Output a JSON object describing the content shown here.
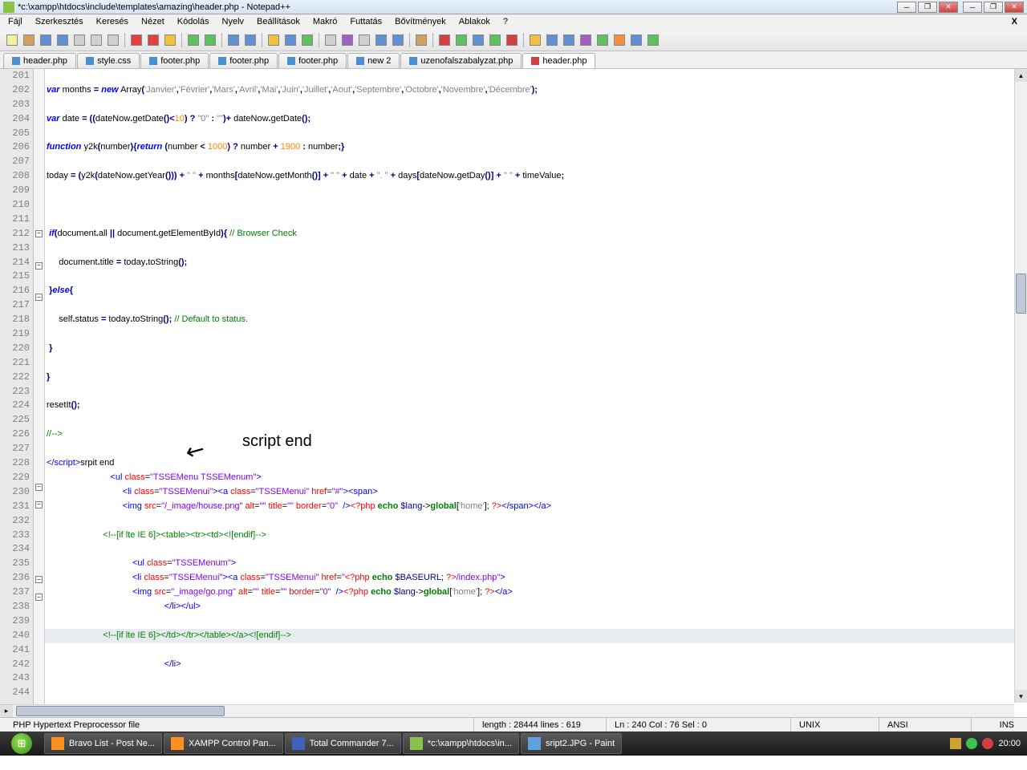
{
  "title": "*c:\\xampp\\htdocs\\include\\templates\\amazing\\header.php - Notepad++",
  "menus": [
    "Fájl",
    "Szerkesztés",
    "Keresés",
    "Nézet",
    "Kódolás",
    "Nyelv",
    "Beállítások",
    "Makró",
    "Futtatás",
    "Bővítmények",
    "Ablakok",
    "?"
  ],
  "tabs": [
    {
      "label": "header.php",
      "active": false,
      "mod": false
    },
    {
      "label": "style.css",
      "active": false,
      "mod": false
    },
    {
      "label": "footer.php",
      "active": false,
      "mod": false
    },
    {
      "label": "footer.php",
      "active": false,
      "mod": false
    },
    {
      "label": "footer.php",
      "active": false,
      "mod": false
    },
    {
      "label": "new  2",
      "active": false,
      "mod": false
    },
    {
      "label": "uzenofalszabalyzat.php",
      "active": false,
      "mod": false
    },
    {
      "label": "header.php",
      "active": true,
      "mod": true
    }
  ],
  "first_line": 201,
  "annotation_text": "script end",
  "status": {
    "filetype": "PHP Hypertext Preprocessor file",
    "length": "length : 28444    lines : 619",
    "pos": "Ln : 240    Col : 76    Sel : 0",
    "eol": "UNIX",
    "enc": "ANSI",
    "mode": "INS"
  },
  "taskbar": [
    {
      "label": "Bravo List - Post Ne...",
      "icon": "#ff9020"
    },
    {
      "label": "XAMPP Control Pan...",
      "icon": "#ff9020"
    },
    {
      "label": "Total Commander 7...",
      "icon": "#4060c0"
    },
    {
      "label": "*c:\\xampp\\htdocs\\in...",
      "icon": "#8bc34a"
    },
    {
      "label": "sript2.JPG - Paint",
      "icon": "#60a0e0"
    }
  ],
  "clock": "20:00",
  "toolbar_icons": [
    "new",
    "open",
    "save",
    "save-all",
    "close",
    "close-all",
    "print",
    "|",
    "cut",
    "copy",
    "paste",
    "|",
    "undo",
    "redo",
    "|",
    "find",
    "replace",
    "|",
    "zoom-in",
    "zoom-out",
    "sync",
    "|",
    "wrap",
    "chars",
    "indent",
    "foldopen",
    "fold",
    "|",
    "folder",
    "|",
    "rec",
    "play",
    "stop",
    "play2",
    "rec2",
    "|",
    "panel1",
    "panel2",
    "panel3",
    "panel4",
    "panel5",
    "panel6",
    "panel7",
    "panel8"
  ],
  "toolbar_colors": [
    "#f0f0a0",
    "#d0a060",
    "#6090d0",
    "#6090d0",
    "#d0d0d0",
    "#d0d0d0",
    "#d0d0d0",
    "",
    "#e04040",
    "#e04040",
    "#f0c040",
    "",
    "#60c060",
    "#60c060",
    "",
    "#6090d0",
    "#6090d0",
    "",
    "#f0c040",
    "#6090d0",
    "#60c060",
    "",
    "#d0d0d0",
    "#a060c0",
    "#d0d0d0",
    "#6090d0",
    "#6090d0",
    "",
    "#d0a060",
    "",
    "#d04040",
    "#60c060",
    "#6090d0",
    "#60c060",
    "#d04040",
    "",
    "#f0c040",
    "#6090d0",
    "#6090d0",
    "#a060c0",
    "#60c060",
    "#f09040",
    "#6090d0",
    "#60c060"
  ]
}
